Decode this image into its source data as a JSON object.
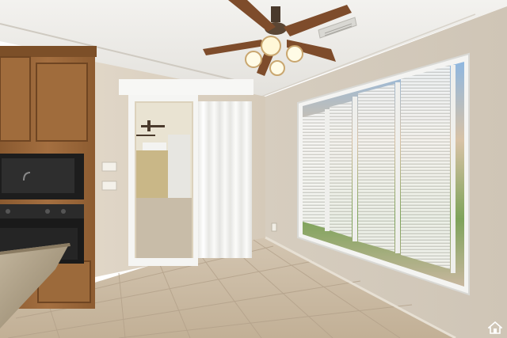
{
  "photo": {
    "subject": "dining-room-with-ceiling-fan-and-shuttered-window",
    "palette": {
      "wall": "#d8cfc1",
      "ceiling": "#eeede9",
      "floor_tile": "#c9b9a3",
      "cabinet_wood": "#9a673a",
      "appliance_black": "#1f1f1f",
      "curtain": "#f2f2f0",
      "shutter_white": "#f6f6f4",
      "granite": "#b6a990",
      "fan_blade": "#7a4a2a"
    },
    "icons": {
      "watermark": "house-icon"
    }
  }
}
